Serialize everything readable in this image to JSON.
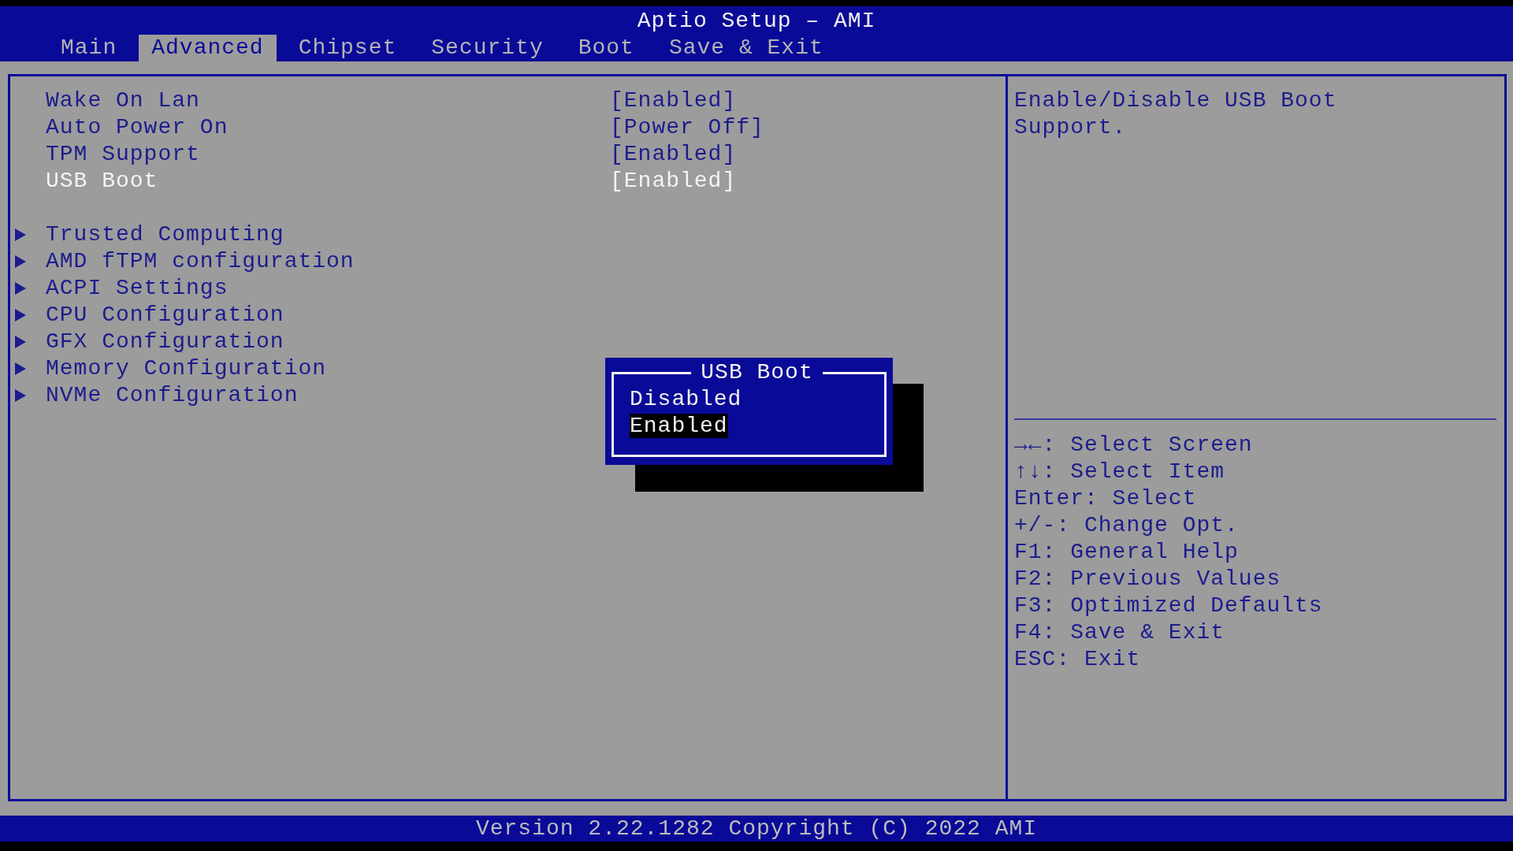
{
  "window": {
    "title": "Aptio Setup – AMI"
  },
  "tabs": [
    {
      "label": "Main",
      "selected": false
    },
    {
      "label": "Advanced",
      "selected": true
    },
    {
      "label": "Chipset",
      "selected": false
    },
    {
      "label": "Security",
      "selected": false
    },
    {
      "label": "Boot",
      "selected": false
    },
    {
      "label": "Save & Exit",
      "selected": false
    }
  ],
  "menu": {
    "groups": [
      [
        {
          "kind": "setting",
          "label": "Wake On Lan",
          "value": "[Enabled]",
          "selected": false
        },
        {
          "kind": "setting",
          "label": "Auto Power On",
          "value": "[Power Off]",
          "selected": false
        },
        {
          "kind": "setting",
          "label": "TPM Support",
          "value": "[Enabled]",
          "selected": false
        },
        {
          "kind": "setting",
          "label": "USB Boot",
          "value": "[Enabled]",
          "selected": true
        }
      ],
      [
        {
          "kind": "submenu",
          "label": "Trusted Computing",
          "selected": false
        },
        {
          "kind": "submenu",
          "label": "AMD fTPM configuration",
          "selected": false
        },
        {
          "kind": "submenu",
          "label": "ACPI Settings",
          "selected": false
        },
        {
          "kind": "submenu",
          "label": "CPU Configuration",
          "selected": false
        },
        {
          "kind": "submenu",
          "label": "GFX Configuration",
          "selected": false
        },
        {
          "kind": "submenu",
          "label": "Memory Configuration",
          "selected": false
        },
        {
          "kind": "submenu",
          "label": "NVMe Configuration",
          "selected": false
        }
      ]
    ]
  },
  "popup": {
    "title": "USB Boot",
    "options": [
      {
        "label": "Disabled",
        "selected": false
      },
      {
        "label": "Enabled",
        "selected": true
      }
    ]
  },
  "help": {
    "text": "Enable/Disable USB Boot Support.",
    "keys": [
      "→←: Select Screen",
      "↑↓: Select Item",
      "Enter: Select",
      "+/-: Change Opt.",
      "F1: General Help",
      "F2: Previous Values",
      "F3: Optimized Defaults",
      "F4: Save & Exit",
      "ESC: Exit"
    ]
  },
  "status_bar": {
    "text": "Version 2.22.1282 Copyright (C) 2022 AMI"
  }
}
